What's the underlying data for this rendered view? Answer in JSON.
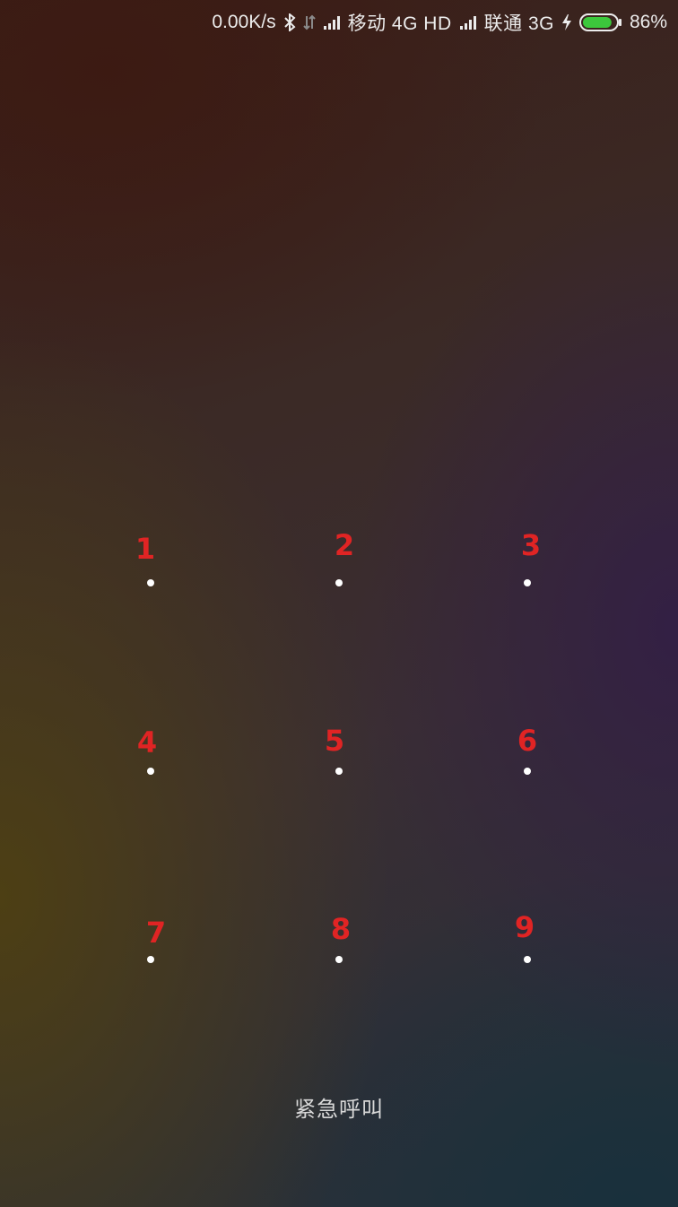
{
  "status_bar": {
    "net_speed": "0.00K/s",
    "carrier1": "移动 4G HD",
    "carrier2": "联通 3G",
    "battery_percent": "86%",
    "battery_level": 0.86,
    "battery_color": "#3cc83c",
    "icons": [
      "bluetooth-icon",
      "data-arrows-icon",
      "signal-icon",
      "charging-icon",
      "battery-icon"
    ]
  },
  "pattern": {
    "number_color": "#e02424",
    "dot_color": "#ffffff",
    "cells": [
      {
        "label": "1"
      },
      {
        "label": "2"
      },
      {
        "label": "3"
      },
      {
        "label": "4"
      },
      {
        "label": "5"
      },
      {
        "label": "6"
      },
      {
        "label": "7"
      },
      {
        "label": "8"
      },
      {
        "label": "9"
      }
    ]
  },
  "emergency_call": {
    "label": "紧急呼叫"
  }
}
